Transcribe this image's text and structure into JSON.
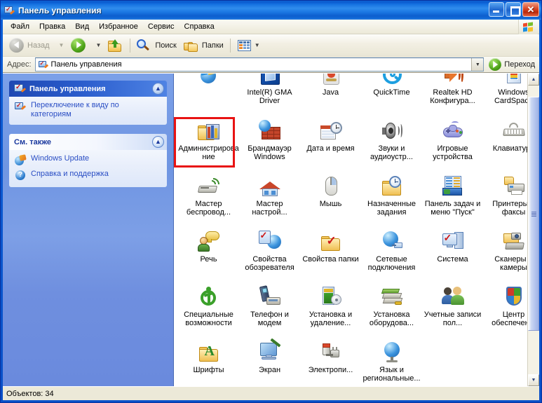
{
  "window": {
    "title": "Панель управления",
    "icon": "control-panel-icon",
    "buttons": {
      "minimize": "_",
      "maximize": "□",
      "close": "✕"
    }
  },
  "menubar": {
    "items": [
      {
        "label": "Файл",
        "accel": "Ф"
      },
      {
        "label": "Правка",
        "accel": "П"
      },
      {
        "label": "Вид",
        "accel": "В"
      },
      {
        "label": "Избранное",
        "accel": "И"
      },
      {
        "label": "Сервис",
        "accel": "е"
      },
      {
        "label": "Справка",
        "accel": "С"
      }
    ],
    "brand_icon": "windows-flag-icon"
  },
  "toolbar": {
    "back": {
      "label": "Назад",
      "icon": "back-arrow-icon",
      "enabled": false
    },
    "forward": {
      "label": "",
      "icon": "forward-arrow-icon",
      "enabled": true
    },
    "up": {
      "label": "",
      "icon": "up-folder-icon"
    },
    "search": {
      "label": "Поиск",
      "icon": "search-icon"
    },
    "folders": {
      "label": "Папки",
      "icon": "folders-icon"
    },
    "views": {
      "label": "",
      "icon": "views-icon"
    }
  },
  "address": {
    "label": "Адрес:",
    "accel": ":",
    "value": "Панель управления",
    "icon": "control-panel-icon",
    "go_label": "Переход",
    "go_icon": "go-arrow-icon"
  },
  "sidebar": {
    "panels": [
      {
        "title": "Панель управления",
        "style": "blue",
        "icon": "control-panel-icon",
        "collapse_icon": "chevron-up-icon",
        "links": [
          {
            "label": "Переключение к виду по категориям",
            "icon": "control-panel-icon"
          }
        ]
      },
      {
        "title": "См. также",
        "style": "white",
        "icon": "",
        "collapse_icon": "chevron-up-icon",
        "links": [
          {
            "label": "Windows Update",
            "icon": "windows-update-icon"
          },
          {
            "label": "Справка и поддержка",
            "icon": "help-icon"
          }
        ]
      }
    ]
  },
  "content": {
    "items": [
      {
        "label": "",
        "icon": "windows-globe-icon",
        "col": 0,
        "row": 0,
        "clipped_top": true
      },
      {
        "label": "Intel(R) GMA Driver",
        "icon": "intel-gma-icon",
        "col": 1,
        "row": 0
      },
      {
        "label": "Java",
        "icon": "java-icon",
        "col": 2,
        "row": 0
      },
      {
        "label": "QuickTime",
        "icon": "quicktime-icon",
        "col": 3,
        "row": 0
      },
      {
        "label": "Realtek HD Конфигура...",
        "icon": "speaker-icon",
        "col": 4,
        "row": 0
      },
      {
        "label": "Windows CardSpace",
        "icon": "cardspace-icon",
        "col": 5,
        "row": 0
      },
      {
        "label": "Администрирование",
        "icon": "admin-tools-icon",
        "col": 0,
        "row": 1,
        "highlighted": true
      },
      {
        "label": "Брандмауэр Windows",
        "icon": "firewall-icon",
        "col": 1,
        "row": 1
      },
      {
        "label": "Дата и время",
        "icon": "date-time-icon",
        "col": 2,
        "row": 1
      },
      {
        "label": "Звуки и аудиоустр...",
        "icon": "sounds-audio-icon",
        "col": 3,
        "row": 1
      },
      {
        "label": "Игровые устройства",
        "icon": "gamepad-icon",
        "col": 4,
        "row": 1
      },
      {
        "label": "Клавиатура",
        "icon": "keyboard-icon",
        "col": 5,
        "row": 1
      },
      {
        "label": "Мастер беспровод...",
        "icon": "wireless-wizard-icon",
        "col": 0,
        "row": 2
      },
      {
        "label": "Мастер настрой...",
        "icon": "network-setup-icon",
        "col": 1,
        "row": 2
      },
      {
        "label": "Мышь",
        "icon": "mouse-icon",
        "col": 2,
        "row": 2
      },
      {
        "label": "Назначенные задания",
        "icon": "scheduled-tasks-icon",
        "col": 3,
        "row": 2
      },
      {
        "label": "Панель задач и меню \"Пуск\"",
        "icon": "taskbar-start-icon",
        "col": 4,
        "row": 2
      },
      {
        "label": "Принтеры и факсы",
        "icon": "printers-faxes-icon",
        "col": 5,
        "row": 2
      },
      {
        "label": "Речь",
        "icon": "speech-icon",
        "col": 0,
        "row": 3
      },
      {
        "label": "Свойства обозревателя",
        "icon": "internet-options-icon",
        "col": 1,
        "row": 3
      },
      {
        "label": "Свойства папки",
        "icon": "folder-options-icon",
        "col": 2,
        "row": 3
      },
      {
        "label": "Сетевые подключения",
        "icon": "network-connections-icon",
        "col": 3,
        "row": 3
      },
      {
        "label": "Система",
        "icon": "system-icon",
        "col": 4,
        "row": 3
      },
      {
        "label": "Сканеры и камеры",
        "icon": "scanners-cameras-icon",
        "col": 5,
        "row": 3
      },
      {
        "label": "Специальные возможности",
        "icon": "accessibility-icon",
        "col": 0,
        "row": 4
      },
      {
        "label": "Телефон и модем",
        "icon": "phone-modem-icon",
        "col": 1,
        "row": 4
      },
      {
        "label": "Установка и удаление...",
        "icon": "add-remove-programs-icon",
        "col": 2,
        "row": 4
      },
      {
        "label": "Установка оборудова...",
        "icon": "add-hardware-icon",
        "col": 3,
        "row": 4
      },
      {
        "label": "Учетные записи пол...",
        "icon": "user-accounts-icon",
        "col": 4,
        "row": 4
      },
      {
        "label": "Центр обеспечен...",
        "icon": "security-center-icon",
        "col": 5,
        "row": 4
      },
      {
        "label": "Шрифты",
        "icon": "fonts-icon",
        "col": 0,
        "row": 5
      },
      {
        "label": "Экран",
        "icon": "display-icon",
        "col": 1,
        "row": 5
      },
      {
        "label": "Электропи...",
        "icon": "power-options-icon",
        "col": 2,
        "row": 5
      },
      {
        "label": "Язык и региональные...",
        "icon": "regional-options-icon",
        "col": 3,
        "row": 5
      }
    ]
  },
  "scrollbar": {
    "up_arrow": "▲",
    "down_arrow": "▼",
    "thumb_top_pct": 4,
    "thumb_height_pct": 81
  },
  "statusbar": {
    "text": "Объектов: 34"
  },
  "colors": {
    "titlebar_blue": "#1470e0",
    "sidebar_blue": "#7ba0e8",
    "panel_header_blue": "#2a5ccc",
    "link_blue": "#2a4ec4",
    "highlight_red": "#e81313",
    "chrome_beige": "#ece9d8"
  }
}
